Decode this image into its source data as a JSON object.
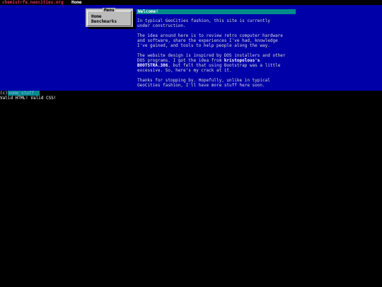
{
  "topbar": {
    "site": "chemistrfe.neocities.org",
    "current_page": "Home"
  },
  "menu": {
    "title": "Menu",
    "items": [
      {
        "label": "Home"
      },
      {
        "label": "Benchmarks"
      }
    ]
  },
  "welcome": {
    "heading": "Welcome!",
    "para1": "In typical GeoCities fashion, this site is currently\nunder construction.",
    "para2": "The idea around here is to review retro computer hardware\nand software, share the experiences I've had, knowledge\nI've gained, and tools to help people along the way.",
    "para3_a": "The website design is inspired by DOS installers and other\nDOS programs. I got the idea from ",
    "para3_link1": "kristopolous's",
    "para3_b": "\n",
    "para3_link2": "BOOTSTRA.386",
    "para3_c": ", but felt that using Bootstrap was a little\nexcessive. So, here's my crack at it.",
    "para4": "Thanks for stopping by. Hopefully, unlike in typical\nGeoCities fashion, I'll have more stuff here soon."
  },
  "footer": {
    "copyright": "(c)",
    "author": "some  stuff",
    "valid": "Valid HTML! Valid CSS!"
  }
}
